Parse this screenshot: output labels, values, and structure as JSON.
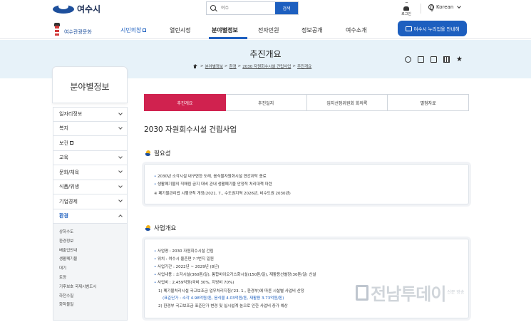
{
  "header": {
    "logo_text": "여수시",
    "search_placeholder": "여수",
    "search_button": "검색",
    "login_label": "로그인",
    "language": "Korean"
  },
  "gnb": {
    "tour_label": "여수관광문화",
    "items": [
      "시민의창",
      "열린시정",
      "분야별정보",
      "전자민원",
      "정보공개",
      "여수소개"
    ],
    "ai_button": "여수시 누리집을 안내해"
  },
  "banner": {
    "title": "추진개요",
    "breadcrumb": [
      "분야별정보",
      "환경",
      "2030 자원회수시설 건립사업",
      "추진개요"
    ]
  },
  "sidebar": {
    "title": "분야별정보",
    "items": [
      "일자리정보",
      "복지",
      "보건",
      "교육",
      "문화/체육",
      "식품/위생",
      "기업경제",
      "환경"
    ],
    "subitems": [
      "상하수도",
      "환경정보",
      "배출업안내",
      "생활폐기물",
      "대기",
      "토양",
      "기후보호 국제시범도시",
      "하천수질",
      "화학물질"
    ]
  },
  "tabs": [
    "추진개요",
    "추진일지",
    "입지선정위원회 회의록",
    "별첨자료"
  ],
  "content": {
    "title": "2030 자원회수시설 건립사업",
    "section1": {
      "heading": "필요성",
      "bullets": [
        "2030년 소각시설 내구연한 도래, 음식물자원화시설 연간위탁 종료",
        "생활폐기물의 직매립 금지 대비 관내 생활폐기물 안정적 처리대책 마련"
      ],
      "note": "※ 폐기물관리법 시행규칙 개정(2021. 7., 수도권지역 2026년, 비수도권 2030년)"
    },
    "section2": {
      "heading": "사업개요",
      "bullets": [
        "사업명 : 2030 자원회수시설 건립",
        "위치 : 여수시 율촌면 ?·?번지 일원",
        "사업기간 : 2022년 ~ 2029년 (8년)",
        "사업내용 : 소각시설(360톤/일), 통합바이오가스화시설(150톤/일), 재활용선별장(30톤/일) 신설",
        "사업비 : 2,459억원(국비 30%, 지방비 70%)"
      ],
      "sub1": "1) 폐기물처리시설 국고보조금 업무처리지침('23. 1., 환경부)에 따른 시설별 사업비 산정",
      "sub1_detail": "(표준단가 : 소각 4.98억원/톤, 음식물 4.03억원/톤, 재활용 3.73억원/톤)",
      "sub2": "2) 환경부 국고보조금 표준단가 변경 및 실시설계 높으로 인한 사업비 증가 예상"
    }
  },
  "watermark": {
    "text": "전남투데이",
    "side": "신문 방송"
  }
}
